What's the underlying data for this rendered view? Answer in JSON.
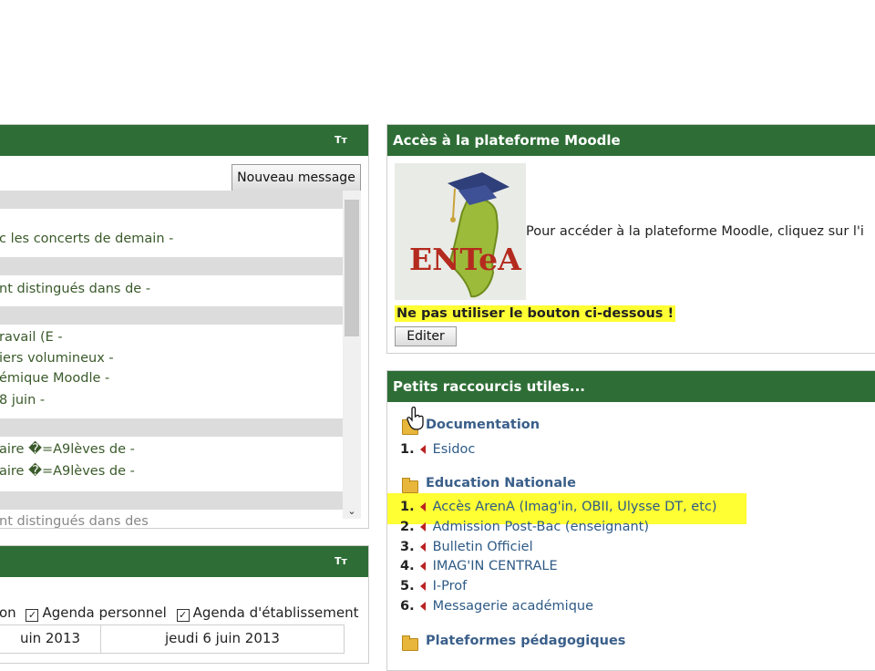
{
  "forum": {
    "tt_label": "Tт",
    "new_message_label": "Nouveau message",
    "messages": [
      "c les concerts de demain -",
      "nt distingués dans de -",
      "ravail (E -",
      "iers volumineux -",
      "émique Moodle -",
      " 8 juin -",
      "aire �=A9lèves de -",
      "aire �=A9lèves de -",
      "nt distingués dans des"
    ]
  },
  "calendar": {
    "tt_label": "Tт",
    "filter_left": "on",
    "filter_personal": "Agenda personnel",
    "filter_school": "Agenda d'établissement",
    "check_mark": "✓",
    "date_left": "uin 2013",
    "date_right": "jeudi 6 juin 2013"
  },
  "moodle": {
    "title": "Accès à la plateforme Moodle",
    "logo_text": "ENTeA",
    "description": "Pour accéder à la plateforme Moodle, cliquez sur l'i",
    "warning": "Ne pas utiliser le bouton ci-dessous !",
    "edit_label": "Editer"
  },
  "shortcuts": {
    "title": "Petits raccourcis utiles...",
    "sections": [
      {
        "title": "Documentation",
        "items": [
          {
            "num": "1.",
            "label": "Esidoc"
          }
        ]
      },
      {
        "title": "Education Nationale",
        "items": [
          {
            "num": "1.",
            "label": "Accès ArenA (Imag'in, OBII, Ulysse DT, etc)"
          },
          {
            "num": "2.",
            "label": "Admission Post-Bac (enseignant)"
          },
          {
            "num": "3.",
            "label": "Bulletin Officiel"
          },
          {
            "num": "4.",
            "label": "IMAG'IN CENTRALE"
          },
          {
            "num": "5.",
            "label": "I-Prof"
          },
          {
            "num": "6.",
            "label": "Messagerie académique"
          }
        ]
      },
      {
        "title": "Plateformes pédagogiques",
        "items": []
      }
    ]
  },
  "colors": {
    "header_green": "#2e6e36",
    "highlight_yellow": "#ffff33",
    "arrow_red": "#b22222"
  }
}
